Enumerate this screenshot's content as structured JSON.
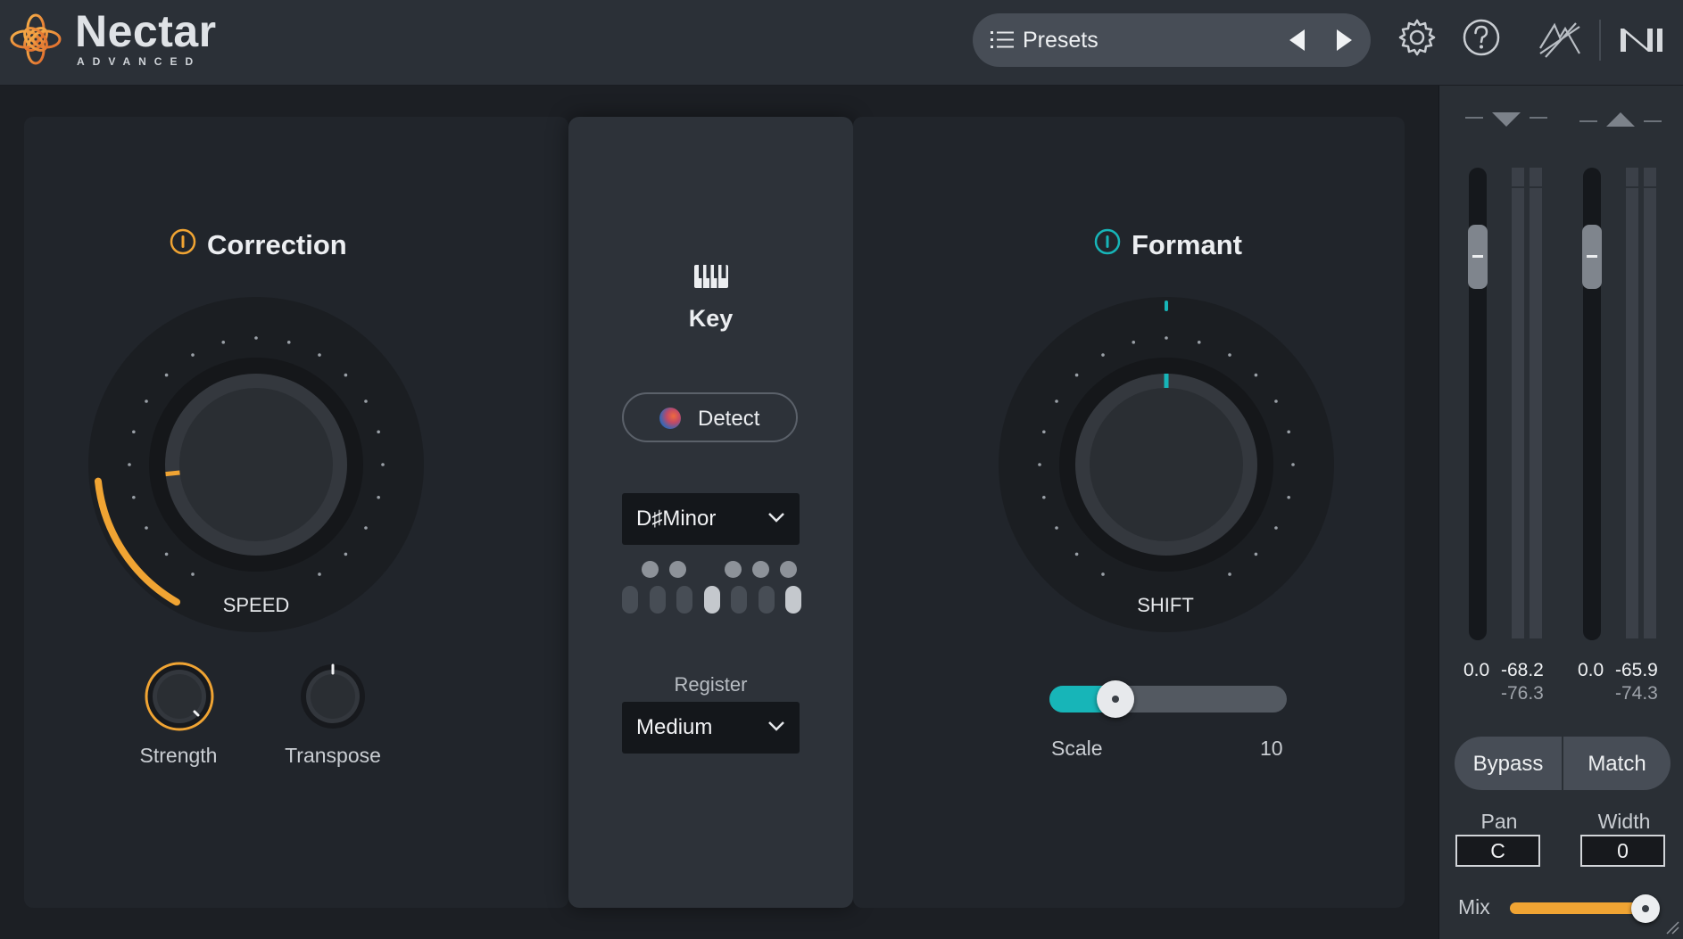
{
  "app": {
    "name": "Nectar",
    "edition": "ADVANCED"
  },
  "header": {
    "presets_label": "Presets",
    "icons": [
      "list-icon",
      "prev-arrow-icon",
      "next-arrow-icon",
      "gear-icon",
      "help-icon",
      "izotope-logo-icon",
      "ni-logo-icon"
    ]
  },
  "correction": {
    "title": "Correction",
    "speed_label": "SPEED",
    "speed_level": 0.18,
    "strength_label": "Strength",
    "transpose_label": "Transpose",
    "colors": {
      "accent": "#f0a433"
    }
  },
  "key": {
    "title": "Key",
    "detect_label": "Detect",
    "key_value": "D♯Minor",
    "register_label": "Register",
    "register_value": "Medium",
    "black_keys_active": [
      true,
      true,
      true,
      true,
      true
    ],
    "white_keys_active": [
      false,
      false,
      false,
      true,
      false,
      false,
      true
    ]
  },
  "formant": {
    "title": "Formant",
    "shift_label": "SHIFT",
    "scale_label": "Scale",
    "scale_value": "10",
    "scale_level": 0.28,
    "colors": {
      "accent": "#17b5b8"
    }
  },
  "meters": {
    "input": {
      "peak": "0.0",
      "level": "-68.2",
      "rms": "-76.3"
    },
    "output": {
      "peak": "0.0",
      "level": "-65.9",
      "rms": "-74.3"
    }
  },
  "sidebar": {
    "bypass_label": "Bypass",
    "match_label": "Match",
    "pan_label": "Pan",
    "pan_value": "C",
    "width_label": "Width",
    "width_value": "0",
    "mix_label": "Mix",
    "mix_level": 0.96
  }
}
